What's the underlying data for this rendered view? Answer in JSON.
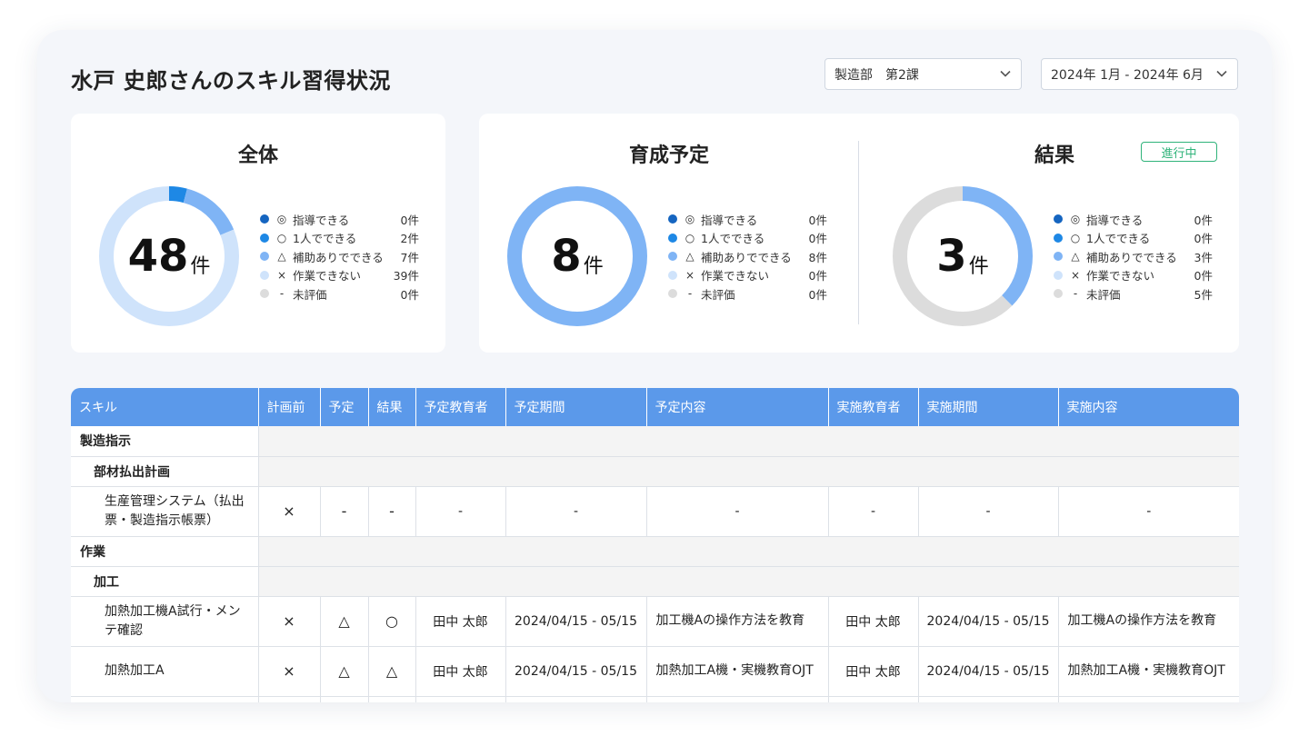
{
  "title": "水戸 史郎さんのスキル習得状況",
  "filters": {
    "department": "製造部　第2課",
    "period": "2024年 1月 - 2024年 6月"
  },
  "colors": {
    "instruct": "#1565c0",
    "alone": "#1e88e5",
    "assisted": "#7fb4f5",
    "cannot": "#cfe3fb",
    "unrated": "#dcdcdc",
    "header": "#5b99ea",
    "badge": "#2fb37a"
  },
  "summary": {
    "all": {
      "title": "全体",
      "total": "48",
      "unit": "件",
      "counts": [
        0,
        2,
        7,
        39,
        0
      ],
      "legend": [
        {
          "sym": "◎",
          "label": "指導できる",
          "count": "0件"
        },
        {
          "sym": "○",
          "label": "1人でできる",
          "count": "2件"
        },
        {
          "sym": "△",
          "label": "補助ありでできる",
          "count": "7件"
        },
        {
          "sym": "×",
          "label": "作業できない",
          "count": "39件"
        },
        {
          "sym": "-",
          "label": "未評価",
          "count": "0件"
        }
      ]
    },
    "plan": {
      "title": "育成予定",
      "total": "8",
      "unit": "件",
      "counts": [
        0,
        0,
        8,
        0,
        0
      ],
      "legend": [
        {
          "sym": "◎",
          "label": "指導できる",
          "count": "0件"
        },
        {
          "sym": "○",
          "label": "1人でできる",
          "count": "0件"
        },
        {
          "sym": "△",
          "label": "補助ありでできる",
          "count": "8件"
        },
        {
          "sym": "×",
          "label": "作業できない",
          "count": "0件"
        },
        {
          "sym": "-",
          "label": "未評価",
          "count": "0件"
        }
      ]
    },
    "result": {
      "title": "結果",
      "badge": "進行中",
      "total": "3",
      "unit": "件",
      "counts": [
        0,
        0,
        3,
        0,
        5
      ],
      "legend": [
        {
          "sym": "◎",
          "label": "指導できる",
          "count": "0件"
        },
        {
          "sym": "○",
          "label": "1人でできる",
          "count": "0件"
        },
        {
          "sym": "△",
          "label": "補助ありでできる",
          "count": "3件"
        },
        {
          "sym": "×",
          "label": "作業できない",
          "count": "0件"
        },
        {
          "sym": "-",
          "label": "未評価",
          "count": "5件"
        }
      ]
    }
  },
  "table": {
    "headers": [
      "スキル",
      "計画前",
      "予定",
      "結果",
      "予定教育者",
      "予定期間",
      "予定内容",
      "実施教育者",
      "実施期間",
      "実施内容"
    ],
    "groups": {
      "g1": "製造指示",
      "g1a": "部材払出計画",
      "g2": "作業",
      "g2a": "加工"
    },
    "rows": [
      {
        "skill": "生産管理システム（払出票・製造指示帳票）",
        "before": "×",
        "plan": "-",
        "result": "-",
        "plan_teacher": "-",
        "plan_period": "-",
        "plan_content": "-",
        "actual_teacher": "-",
        "actual_period": "-",
        "actual_content": "-"
      },
      {
        "skill": "加熱加工機A試行・メンテ確認",
        "before": "×",
        "plan": "△",
        "result": "○",
        "plan_teacher": "田中 太郎",
        "plan_period": "2024/04/15 - 05/15",
        "plan_content": "加工機Aの操作方法を教育",
        "actual_teacher": "田中 太郎",
        "actual_period": "2024/04/15 - 05/15",
        "actual_content": "加工機Aの操作方法を教育"
      },
      {
        "skill": "加熱加工A",
        "before": "×",
        "plan": "△",
        "result": "△",
        "plan_teacher": "田中 太郎",
        "plan_period": "2024/04/15 - 05/15",
        "plan_content": "加熱加工A機・実機教育OJT",
        "actual_teacher": "田中 太郎",
        "actual_period": "2024/04/15 - 05/15",
        "actual_content": "加熱加工A機・実機教育OJT"
      }
    ]
  }
}
